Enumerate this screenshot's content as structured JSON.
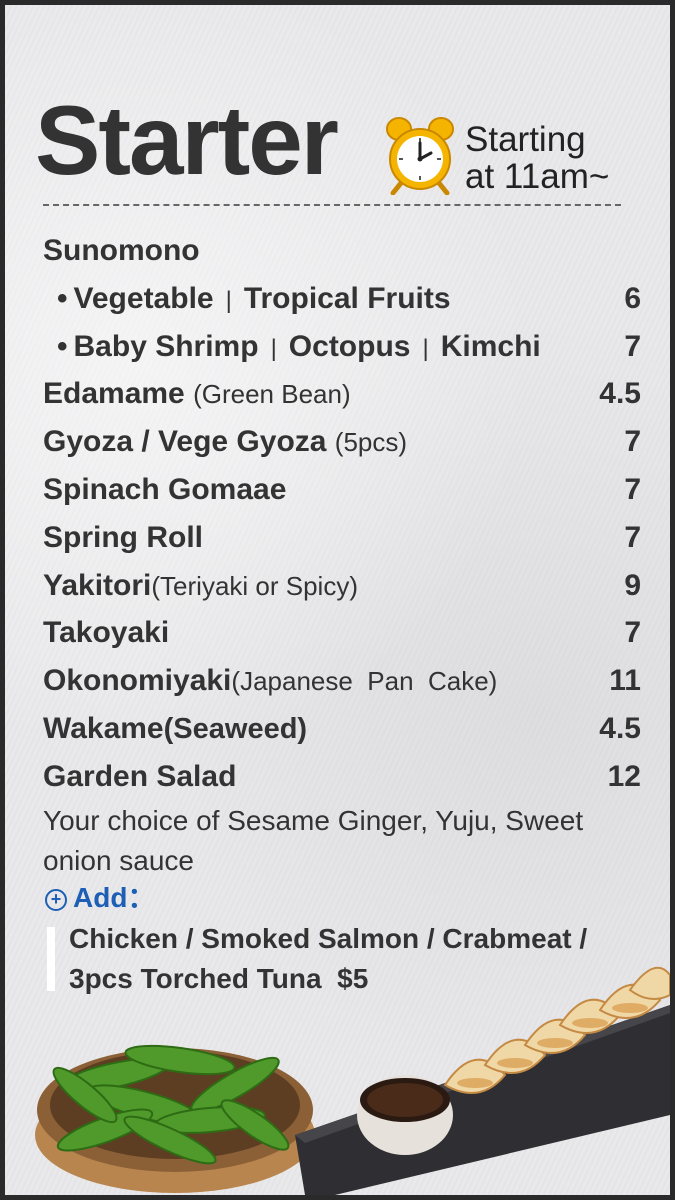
{
  "header": {
    "title": "Starter",
    "starting_line1": "Starting",
    "starting_line2": "at 11am~",
    "clock_icon": "alarm-clock-icon"
  },
  "menu": {
    "items": [
      {
        "name": "Sunomono",
        "note": "",
        "price": ""
      },
      {
        "sub": true,
        "parts": [
          "Vegetable",
          "Tropical Fruits"
        ],
        "price": "6"
      },
      {
        "sub": true,
        "parts": [
          "Baby Shrimp",
          "Octopus",
          "Kimchi"
        ],
        "price": "7"
      },
      {
        "name": "Edamame ",
        "note": "(Green Bean)",
        "price": "4.5"
      },
      {
        "name": "Gyoza / Vege Gyoza ",
        "note": "(5pcs)",
        "price": "7"
      },
      {
        "name": "Spinach Gomaae",
        "note": "",
        "price": "7"
      },
      {
        "name": "Spring Roll",
        "note": "",
        "price": "7"
      },
      {
        "name": "Yakitori",
        "note": "(Teriyaki or Spicy)",
        "price": "9"
      },
      {
        "name": "Takoyaki",
        "note": "",
        "price": "7"
      },
      {
        "name": "Okonomiyaki",
        "note": "(Japanese  Pan  Cake)",
        "price": "11"
      },
      {
        "name": "Wakame",
        "note": "(Seaweed)",
        "price": "4.5"
      },
      {
        "name": "Garden Salad",
        "note": "",
        "price": "12"
      }
    ],
    "salad_description": "Your choice of Sesame Ginger, Yuju, Sweet onion sauce",
    "add_label": "Add：",
    "add_options": "Chicken / Smoked Salmon / Crabmeat / 3pcs Torched Tuna  $5"
  },
  "colors": {
    "accent": "#1d5fb4",
    "text": "#333333",
    "background": "#e9e9eb"
  }
}
